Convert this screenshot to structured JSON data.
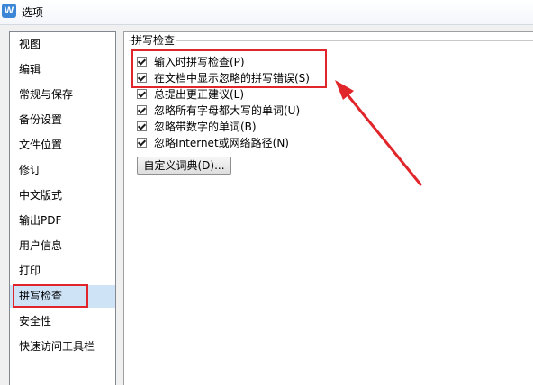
{
  "window": {
    "title": "选项",
    "app_icon_letter": "W"
  },
  "nav": {
    "items": [
      "视图",
      "编辑",
      "常规与保存",
      "备份设置",
      "文件位置",
      "修订",
      "中文版式",
      "输出PDF",
      "用户信息",
      "打印",
      "拼写检查",
      "安全性",
      "快速访问工具栏"
    ],
    "selected": "拼写检查"
  },
  "spellcheck": {
    "group_title": "拼写检查",
    "options": [
      {
        "label": "输入时拼写检查(P)",
        "checked": true
      },
      {
        "label": "在文档中显示忽略的拼写错误(S)",
        "checked": true
      },
      {
        "label": "总提出更正建议(L)",
        "checked": true
      },
      {
        "label": "忽略所有字母都大写的单词(U)",
        "checked": true
      },
      {
        "label": "忽略带数字的单词(B)",
        "checked": true
      },
      {
        "label": "忽略Internet或网络路径(N)",
        "checked": true
      }
    ],
    "custom_dict_button": "自定义词典(D)..."
  },
  "colors": {
    "highlight": "#e0262b",
    "nav_selected": "#cfe3f7",
    "icon": "#3b86d6"
  }
}
